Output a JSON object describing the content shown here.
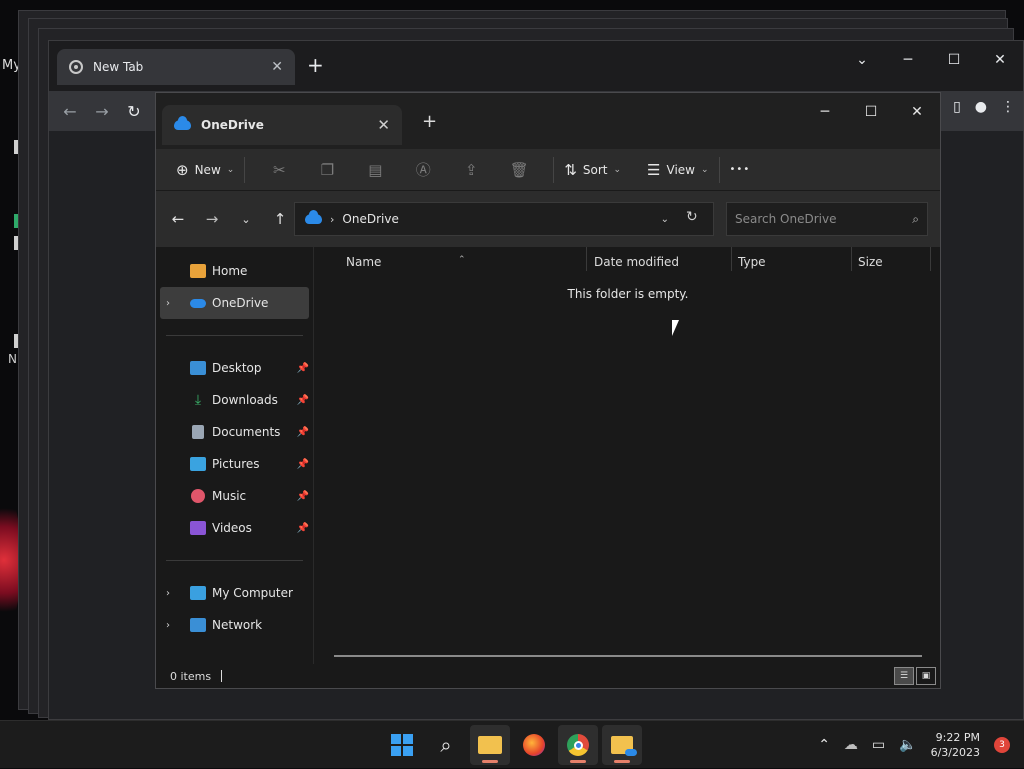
{
  "desktop": {
    "partial_label": "My",
    "partial_n": "N"
  },
  "browser": {
    "tab_title": "New Tab",
    "tab_close": "✕",
    "new_tab": "+",
    "win_min": "─",
    "win_max": "☐",
    "win_close": "✕",
    "win_dropdown": "⌄"
  },
  "explorer": {
    "tab_title": "OneDrive",
    "tab_close": "✕",
    "new_tab": "+",
    "win_min": "─",
    "win_max": "☐",
    "win_close": "✕",
    "cmdbar": {
      "new_label": "New",
      "sort_label": "Sort",
      "view_label": "View",
      "more": "•••"
    },
    "address": {
      "path": "OneDrive",
      "search_placeholder": "Search OneDrive"
    },
    "nav": {
      "top": [
        {
          "label": "Home",
          "icon": "home-icon",
          "color": "#e8a23a"
        },
        {
          "label": "OneDrive",
          "icon": "onedrive-icon",
          "color": "#2b8ae8",
          "selected": true
        }
      ],
      "pinned": [
        {
          "label": "Desktop",
          "icon": "desktop-icon",
          "color": "#3a8fd6"
        },
        {
          "label": "Downloads",
          "icon": "downloads-icon",
          "color": "#3ab36a"
        },
        {
          "label": "Documents",
          "icon": "documents-icon",
          "color": "#9aa6b4"
        },
        {
          "label": "Pictures",
          "icon": "pictures-icon",
          "color": "#3aa3e0"
        },
        {
          "label": "Music",
          "icon": "music-icon",
          "color": "#e0566a"
        },
        {
          "label": "Videos",
          "icon": "videos-icon",
          "color": "#8a55d6"
        }
      ],
      "bottom": [
        {
          "label": "My Computer",
          "icon": "computer-icon",
          "color": "#3aa0e0"
        },
        {
          "label": "Network",
          "icon": "network-icon",
          "color": "#3a8fd6"
        }
      ]
    },
    "columns": [
      "Name",
      "Date modified",
      "Type",
      "Size"
    ],
    "empty_message": "This folder is empty.",
    "status": "0 items"
  },
  "taskbar": {
    "apps": [
      {
        "name": "start",
        "icon": "windows-start-icon"
      },
      {
        "name": "search",
        "icon": "search-icon"
      },
      {
        "name": "file-explorer",
        "icon": "folder-icon"
      },
      {
        "name": "firefox",
        "icon": "firefox-icon"
      },
      {
        "name": "chrome",
        "icon": "chrome-icon"
      },
      {
        "name": "onedrive-folder",
        "icon": "folder-cloud-icon"
      }
    ],
    "time": "9:22 PM",
    "date": "6/3/2023",
    "notification_count": "3"
  }
}
